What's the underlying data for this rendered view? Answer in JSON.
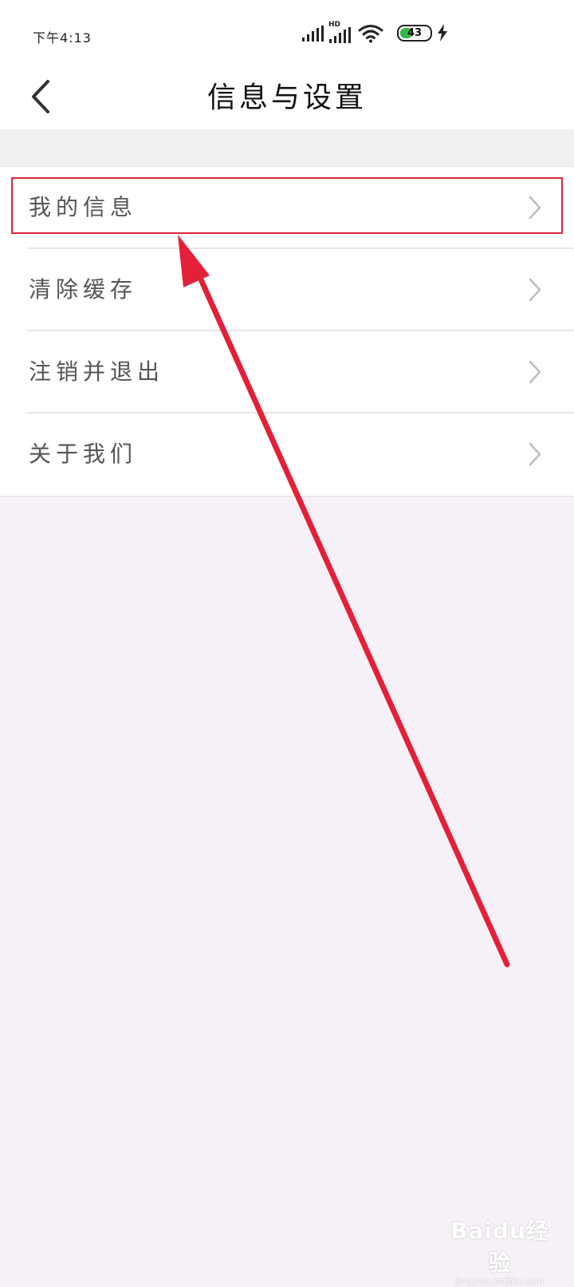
{
  "status_bar": {
    "time": "下午4:13",
    "network_label": "HD",
    "battery_percent": 43,
    "battery_text": "43",
    "icons": [
      "signal-icon",
      "signal-hd-icon",
      "wifi-icon",
      "battery-icon",
      "charging-icon"
    ]
  },
  "header": {
    "title": "信息与设置",
    "back_icon": "chevron-left-icon"
  },
  "menu": {
    "items": [
      {
        "label": "我的信息"
      },
      {
        "label": "清除缓存"
      },
      {
        "label": "注销并退出"
      },
      {
        "label": "关于我们"
      }
    ],
    "item_icon": "chevron-right-icon"
  },
  "annotation": {
    "highlight_color": "#d8283a",
    "arrow_color": "#e41f38"
  },
  "watermark": {
    "main": "Baidu经验",
    "sub": "jingyan.baidu.com"
  },
  "colors": {
    "background": "#f6f1f6",
    "surface": "#ffffff",
    "band": "#f1f1f1",
    "battery_green": "#39b54a"
  }
}
